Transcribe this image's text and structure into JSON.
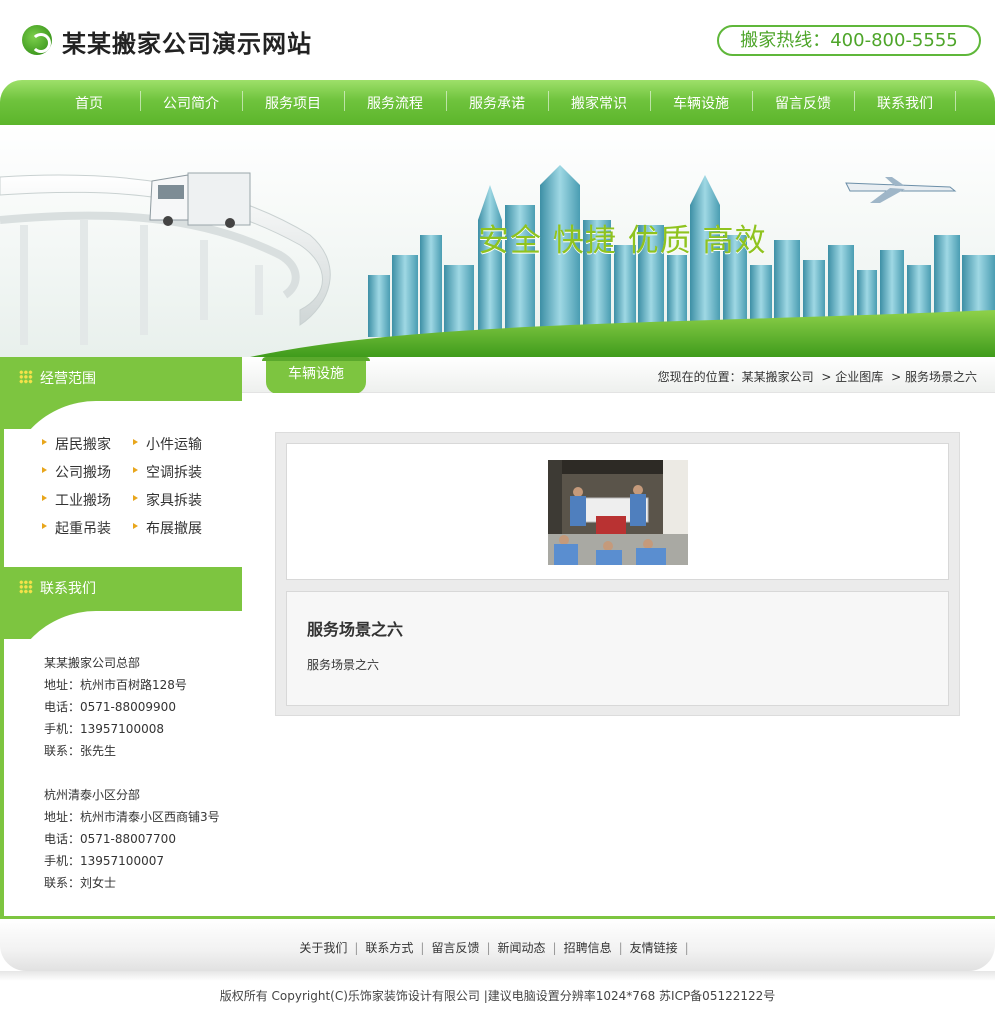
{
  "header": {
    "site_title": "某某搬家公司演示网站",
    "hotline": "搬家热线：400-800-5555"
  },
  "nav": {
    "items": [
      "首页",
      "公司简介",
      "服务项目",
      "服务流程",
      "服务承诺",
      "搬家常识",
      "车辆设施",
      "留言反馈",
      "联系我们"
    ]
  },
  "banner": {
    "slogan": "安全 快捷 优质 高效"
  },
  "sidebar": {
    "scope_title": "经营范围",
    "services": [
      "居民搬家",
      "小件运输",
      "公司搬场",
      "空调拆装",
      "工业搬场",
      "家具拆装",
      "起重吊装",
      "布展撤展"
    ],
    "contact_title": "联系我们",
    "contact_lines": [
      "某某搬家公司总部",
      "地址：杭州市百树路128号",
      "电话：0571-88009900",
      "手机：13957100008",
      "联系：张先生",
      "",
      "杭州清泰小区分部",
      "地址：杭州市清泰小区西商铺3号",
      "电话：0571-88007700",
      "手机：13957100007",
      "联系：刘女士"
    ]
  },
  "main": {
    "tab_label": "车辆设施",
    "breadcrumb": {
      "prefix": "您现在的位置：某某搬家公司",
      "items": [
        "> 企业图库",
        "> 服务场景之六"
      ]
    },
    "article_title": "服务场景之六",
    "article_desc": "服务场景之六"
  },
  "footer": {
    "links": [
      "关于我们",
      "联系方式",
      "留言反馈",
      "新闻动态",
      "招聘信息",
      "友情链接"
    ],
    "copyright": "版权所有  Copyright(C)乐饰家装饰设计有限公司  |建议电脑设置分辨率1024*768 苏ICP备05122122号"
  },
  "colors": {
    "brand_green": "#7dc540",
    "slogan_green": "#8fc31f",
    "arrow_orange": "#e8a61c"
  }
}
